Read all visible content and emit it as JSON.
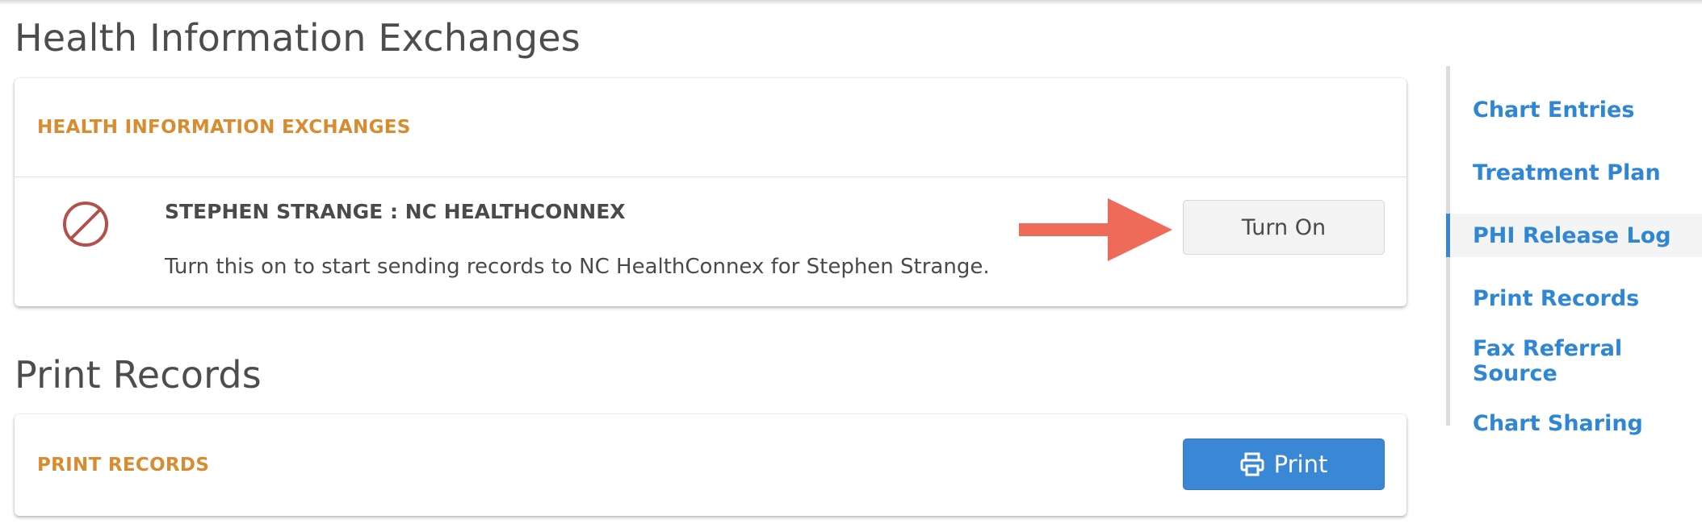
{
  "sections": {
    "hie": {
      "title": "Health Information Exchanges",
      "card_label": "HEALTH INFORMATION EXCHANGES",
      "entry": {
        "name": "STEPHEN STRANGE : NC HEALTHCONNEX",
        "description": "Turn this on to start sending records to NC HealthConnex for Stephen Strange.",
        "button_label": "Turn On",
        "status_icon": "blocked-icon"
      }
    },
    "print": {
      "title": "Print Records",
      "card_label": "PRINT RECORDS",
      "button_label": "Print",
      "button_icon": "printer-icon"
    }
  },
  "side_nav": {
    "items": [
      {
        "label": "Chart Entries",
        "active": false
      },
      {
        "label": "Treatment Plan",
        "active": false
      },
      {
        "label": "PHI Release Log",
        "active": true
      },
      {
        "label": "Print Records",
        "active": false
      },
      {
        "label": "Fax Referral Source",
        "active": false
      },
      {
        "label": "Chart Sharing",
        "active": false
      }
    ]
  },
  "colors": {
    "accent_orange": "#d98b2f",
    "link_blue": "#2f86d3",
    "primary_button": "#3a87d6",
    "annotation_arrow": "#ee6b5a",
    "blocked_icon": "#b3504a"
  }
}
